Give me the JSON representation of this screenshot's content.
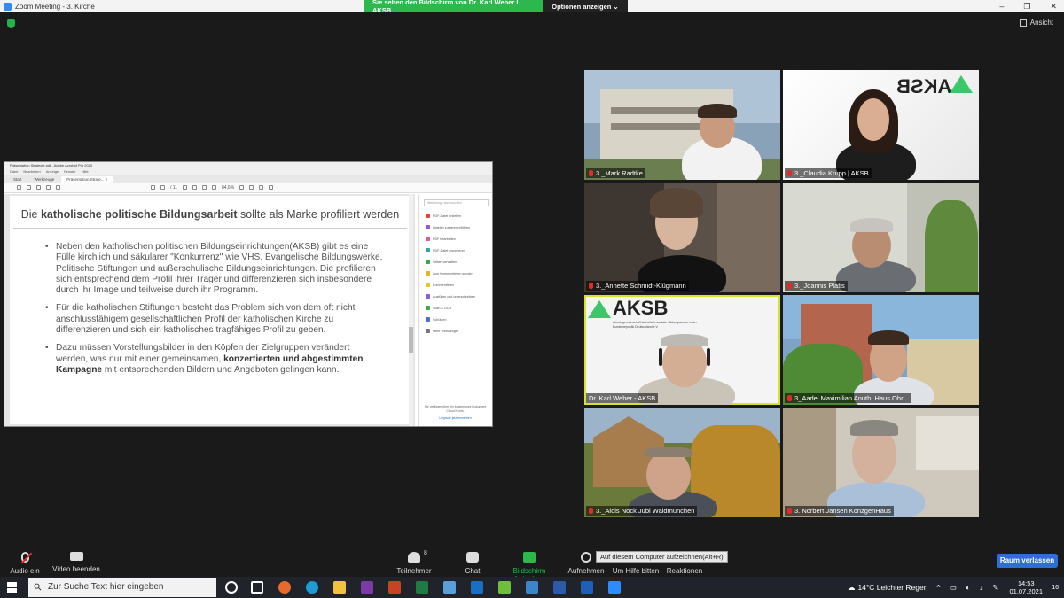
{
  "window": {
    "title": "Zoom Meeting - 3. Kirche",
    "min": "–",
    "max": "❐",
    "close": "✕"
  },
  "share_banner": {
    "message": "Sie sehen den Bildschirm von Dr. Karl Weber I AKSB",
    "options": "Optionen anzeigen ⌄"
  },
  "view_button": "Ansicht",
  "acrobat": {
    "title": "Präsentation Strategie.pdf - Adobe Acrobat Pro 2020",
    "menu": [
      "Datei",
      "Bearbeiten",
      "Anzeige",
      "Fenster",
      "Hilfe"
    ],
    "tabs": [
      "Start",
      "Werkzeuge",
      "Präsentation Strate... ×"
    ],
    "zoom": "84,6%",
    "page": "/ 11",
    "tools_search": "Werkzeuge durchsuchen",
    "tools": [
      {
        "label": "PDF-Datei erstellen",
        "color": "#e5443b"
      },
      {
        "label": "Dateien zusammenführen",
        "color": "#8c5bd6"
      },
      {
        "label": "PDF bearbeiten",
        "color": "#e35a9c"
      },
      {
        "label": "PDF-Datei exportieren",
        "color": "#2fa6a8"
      },
      {
        "label": "Seiten verwalten",
        "color": "#3ca84c"
      },
      {
        "label": "Zum Kommentieren senden",
        "color": "#e0b52a"
      },
      {
        "label": "Kommentieren",
        "color": "#f0c22a"
      },
      {
        "label": "Ausfüllen und unterschreiben",
        "color": "#8c5bd6"
      },
      {
        "label": "Scan & OCR",
        "color": "#3ca84c"
      },
      {
        "label": "Schützen",
        "color": "#4a6fd0"
      },
      {
        "label": "Mehr Werkzeuge",
        "color": "#777777"
      }
    ],
    "footer_text": "Sie verfügen über ein kostenloses Dokument Cloud Konto.",
    "footer_link": "Upgrade jetzt erwerben"
  },
  "slide": {
    "title_pre": "Die ",
    "title_bold": "katholische politische Bildungsarbeit",
    "title_post": " sollte als Marke profiliert werden",
    "bullets": [
      {
        "pre": "Neben den katholischen politischen Bildungseinrichtungen(AKSB) gibt es eine Fülle kirchlich und säkularer \"Konkurrenz\" wie VHS, Evangelische Bildungswerke, Politische Stiftungen und außerschulische Bildungseinrichtungen. Die profilieren sich entsprechend dem Profil ihrer Träger und differenzieren sich insbesondere durch ihr Image und teilweise durch ihr Programm.",
        "bold": "",
        "post": ""
      },
      {
        "pre": "Für die katholischen Stiftungen besteht das Problem sich von dem oft nicht anschlussfähigem gesellschaftlichen Profil der katholischen Kirche zu differenzieren und sich ein katholisches tragfähiges Profil zu geben.",
        "bold": "",
        "post": ""
      },
      {
        "pre": "Dazu müssen Vorstellungsbilder in den Köpfen der Zielgruppen verändert werden, was nur mit einer gemeinsamen, ",
        "bold": "konzertierten und abgestimmten Kampagne",
        "post": " mit entsprechenden Bildern und Angeboten gelingen kann."
      }
    ]
  },
  "participants": [
    {
      "name": "3._Mark Radtke"
    },
    {
      "name": "3._Claudia Krupp | AKSB"
    },
    {
      "name": "3._Annette Schmidt-Klügmann"
    },
    {
      "name": "3._Joannis Platis"
    },
    {
      "name": "Dr. Karl Weber - AKSB"
    },
    {
      "name": "3_Aadel Maximilian Anuth, Haus Ohr..."
    },
    {
      "name": "3._Alois Nock Jubi Waldmünchen"
    },
    {
      "name": "3. Norbert Jansen KönzgenHaus"
    }
  ],
  "logo_text": "AKSB",
  "logo_sub": "Arbeitsgemeinschaft katholisch-sozialer Bildungswerke in der Bundesrepublik Deutschland e.V.",
  "controls": {
    "audio": "Audio ein",
    "video": "Video beenden",
    "participants": "Teilnehmer",
    "participants_count": "8",
    "chat": "Chat",
    "share": "Bildschirm freigeben",
    "record": "Aufnehmen",
    "help": "Um Hilfe bitten",
    "reactions": "Reaktionen",
    "record_tip": "Auf diesem Computer aufzeichnen(Alt+R)",
    "leave": "Raum verlassen"
  },
  "taskbar": {
    "search_placeholder": "Zur Suche Text hier eingeben",
    "weather": "14°C  Leichter Regen",
    "time": "14:53",
    "date": "01.07.2021",
    "notifications": "16"
  }
}
